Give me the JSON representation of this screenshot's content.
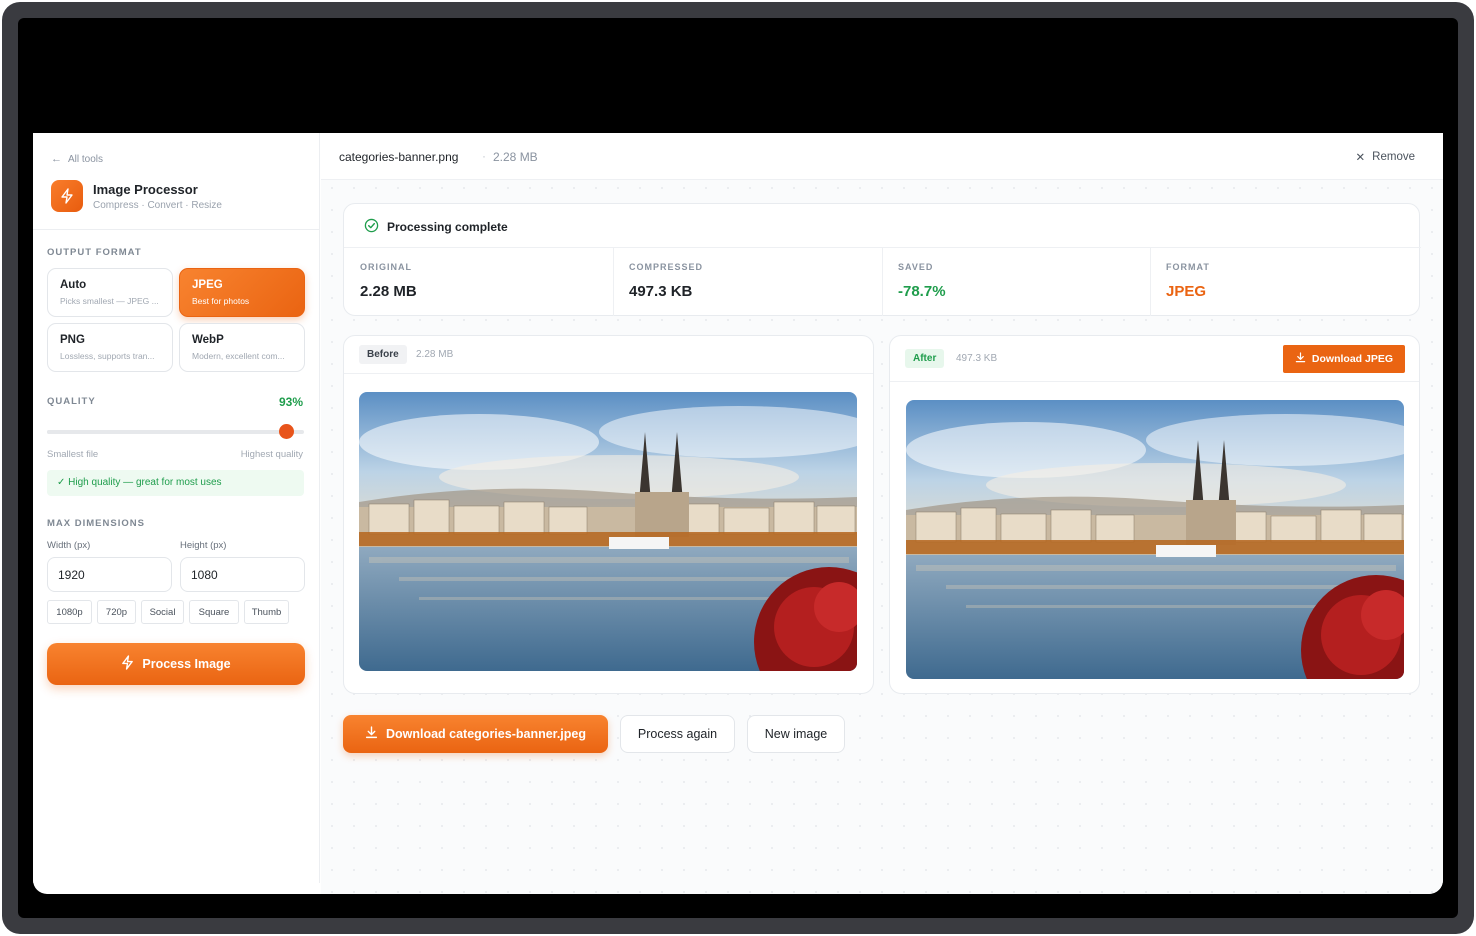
{
  "sidebar": {
    "back_label": "All tools",
    "app_title": "Image Processor",
    "app_subtitle": "Compress · Convert · Resize",
    "output_format_label": "OUTPUT FORMAT",
    "formats": [
      {
        "name": "Auto",
        "desc": "Picks smallest — JPEG ...",
        "selected": false
      },
      {
        "name": "JPEG",
        "desc": "Best for photos",
        "selected": true
      },
      {
        "name": "PNG",
        "desc": "Lossless, supports tran...",
        "selected": false
      },
      {
        "name": "WebP",
        "desc": "Modern, excellent com...",
        "selected": false
      }
    ],
    "quality_label": "QUALITY",
    "quality_value": "93%",
    "quality_fraction": 0.93,
    "slider_min_label": "Smallest file",
    "slider_max_label": "Highest quality",
    "quality_hint": "✓ High quality — great for most uses",
    "max_dimensions_label": "MAX DIMENSIONS",
    "width_label": "Width (px)",
    "width_value": "1920",
    "height_label": "Height (px)",
    "height_value": "1080",
    "presets": [
      "1080p",
      "720p",
      "Social",
      "Square",
      "Thumb"
    ],
    "process_button": "Process Image"
  },
  "topbar": {
    "filename": "categories-banner.png",
    "separator": "·",
    "filesize": "2.28 MB",
    "remove_label": "Remove"
  },
  "status": {
    "title": "Processing complete",
    "stats": [
      {
        "label": "ORIGINAL",
        "value": "2.28 MB",
        "color": "#1f2328"
      },
      {
        "label": "COMPRESSED",
        "value": "497.3 KB",
        "color": "#1f2328"
      },
      {
        "label": "SAVED",
        "value": "-78.7%",
        "color": "#1f9d4c"
      },
      {
        "label": "FORMAT",
        "value": "JPEG",
        "color": "#ea6412"
      }
    ]
  },
  "before": {
    "tag": "Before",
    "size": "2.28 MB"
  },
  "after": {
    "tag": "After",
    "size": "497.3 KB",
    "download_label": "Download JPEG"
  },
  "actions": {
    "download_label": "Download categories-banner.jpeg",
    "process_again_label": "Process again",
    "new_image_label": "New image"
  },
  "colors": {
    "accent": "#ea6412",
    "success": "#1f9d4c"
  }
}
